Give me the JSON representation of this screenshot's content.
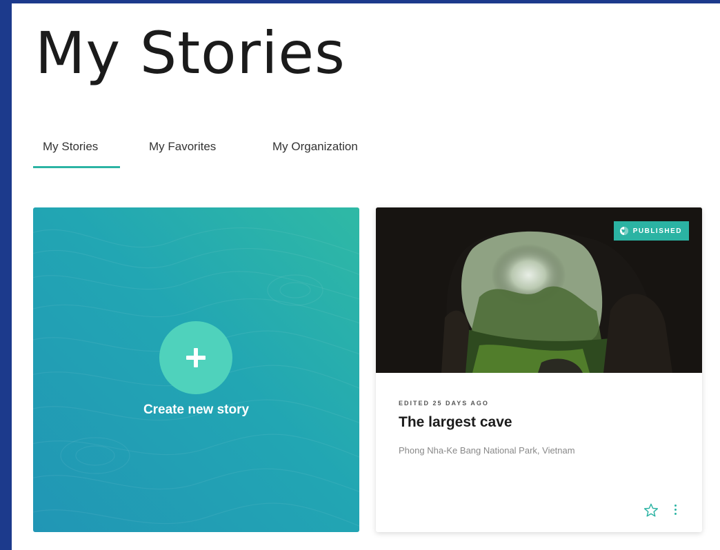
{
  "page": {
    "title": "My Stories"
  },
  "tabs": [
    {
      "label": "My Stories",
      "active": true
    },
    {
      "label": "My Favorites",
      "active": false
    },
    {
      "label": "My Organization",
      "active": false
    }
  ],
  "create_card": {
    "label": "Create new story",
    "icon": "plus-icon"
  },
  "stories": [
    {
      "status": "PUBLISHED",
      "edited": "EDITED 25 DAYS AGO",
      "title": "The largest cave",
      "subtitle": "Phong Nha-Ke Bang National Park, Vietnam"
    }
  ],
  "colors": {
    "accent": "#2bb3a3",
    "create_gradient_start": "#2196b5",
    "create_gradient_end": "#2fb9a5",
    "plus_circle": "#4fd2bc",
    "outer_border": "#1c3a8c"
  }
}
